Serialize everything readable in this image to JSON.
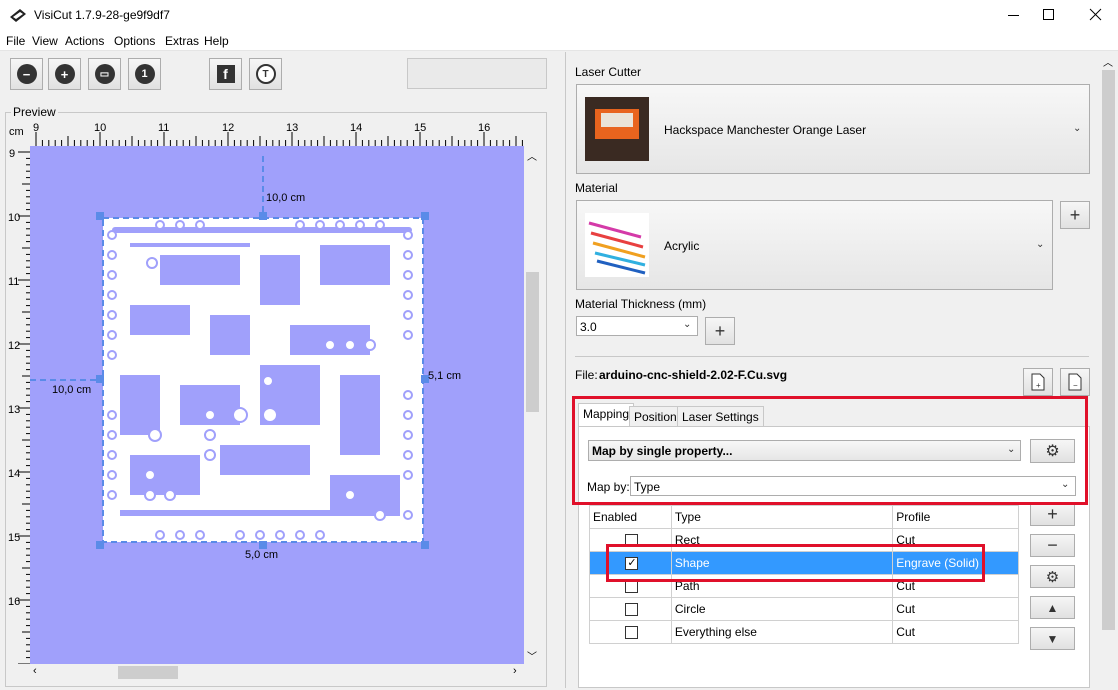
{
  "window": {
    "title": "VisiCut 1.7.9-28-ge9f9df7"
  },
  "menu": [
    "File",
    "View",
    "Actions",
    "Options",
    "Extras",
    "Help"
  ],
  "toolbar": {
    "zoom_out": "zoom-out-icon",
    "zoom_in": "zoom-in-icon",
    "zoom_fit": "zoom-fit-icon",
    "zoom_100": "zoom-100-icon",
    "facebook": "facebook-icon",
    "thingiverse": "thingiverse-icon",
    "zoom_100_glyph": "1",
    "facebook_glyph": "f",
    "thingiverse_glyph": "T"
  },
  "preview": {
    "label": "Preview",
    "unit": "cm",
    "h_ticks": [
      "9",
      "10",
      "11",
      "12",
      "13",
      "14",
      "15",
      "16"
    ],
    "v_ticks": [
      "9",
      "10",
      "11",
      "12",
      "13",
      "14",
      "15",
      "16"
    ],
    "dim_top": "10,0 cm",
    "dim_left": "10,0 cm",
    "dim_right": "5,1 cm",
    "dim_bottom": "5,0 cm"
  },
  "laser": {
    "section_label": "Laser Cutter",
    "name": "Hackspace Manchester Orange Laser"
  },
  "material": {
    "section_label": "Material",
    "name": "Acrylic",
    "thickness_label": "Material Thickness (mm)",
    "thickness_value": "3.0"
  },
  "file": {
    "label": "File:",
    "name": "arduino-cnc-shield-2.02-F.Cu.svg"
  },
  "tabs": [
    "Mapping",
    "Position",
    "Laser Settings"
  ],
  "mapping": {
    "mode": "Map by single property...",
    "map_by_label": "Map by:",
    "map_by_value": "Type",
    "columns": [
      "Enabled",
      "Type",
      "Profile"
    ],
    "rows": [
      {
        "enabled": false,
        "type": "Rect",
        "profile": "Cut",
        "selected": false
      },
      {
        "enabled": true,
        "type": "Shape",
        "profile": "Engrave (Solid)",
        "selected": true
      },
      {
        "enabled": false,
        "type": "Path",
        "profile": "Cut",
        "selected": false
      },
      {
        "enabled": false,
        "type": "Circle",
        "profile": "Cut",
        "selected": false
      },
      {
        "enabled": false,
        "type": "Everything else",
        "profile": "Cut",
        "selected": false
      }
    ]
  },
  "colors": {
    "canvas": "#a0a0fb",
    "selection": "#3399ff",
    "highlight": "#e0102a",
    "handle": "#5a8be8"
  }
}
